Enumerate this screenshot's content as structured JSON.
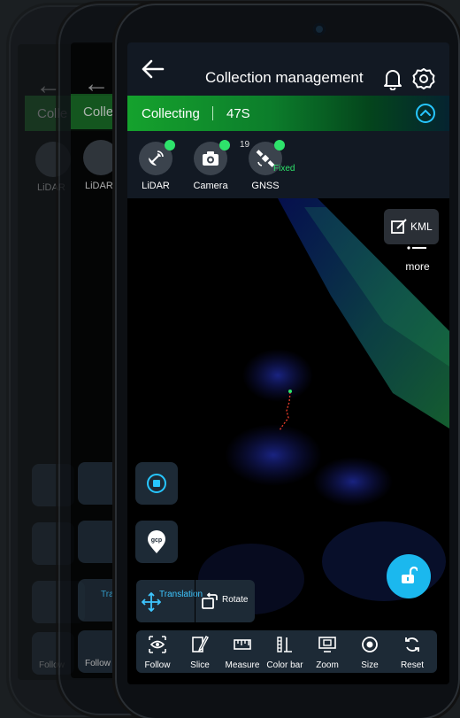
{
  "app": {
    "title": "Collection management"
  },
  "collection": {
    "status": "Collecting",
    "count": "47S"
  },
  "sensors": [
    {
      "label": "LiDAR",
      "icon": "satellite-dish-icon",
      "status_color": "#2ee36b"
    },
    {
      "label": "Camera",
      "icon": "camera-icon",
      "status_color": "#2ee36b"
    },
    {
      "label": "GNSS",
      "icon": "satellite-icon",
      "status_color": "#2ee36b",
      "satellites": "19",
      "fix": "Fixed"
    }
  ],
  "more": {
    "label": "more"
  },
  "kml": {
    "label": "KML"
  },
  "transform": {
    "translation_label": "Translation",
    "rotate_label": "Rotate"
  },
  "tools": [
    {
      "label": "Follow",
      "icon": "eye-icon"
    },
    {
      "label": "Slice",
      "icon": "slice-icon"
    },
    {
      "label": "Measure",
      "icon": "ruler-icon"
    },
    {
      "label": "Color bar",
      "icon": "color-bar-icon"
    },
    {
      "label": "Zoom",
      "icon": "zoom-icon"
    },
    {
      "label": "Size",
      "icon": "size-icon"
    },
    {
      "label": "Reset",
      "icon": "reset-icon"
    }
  ],
  "ghost": {
    "collect_short": "Colle",
    "lidar_label": "LiDAR",
    "follow_label": "Follow",
    "translation_short": "Transl"
  },
  "colors": {
    "accent": "#27c6ff",
    "collecting_green": "#15a22d",
    "status_ok": "#2ee36b",
    "panel": "#1d2a36"
  }
}
